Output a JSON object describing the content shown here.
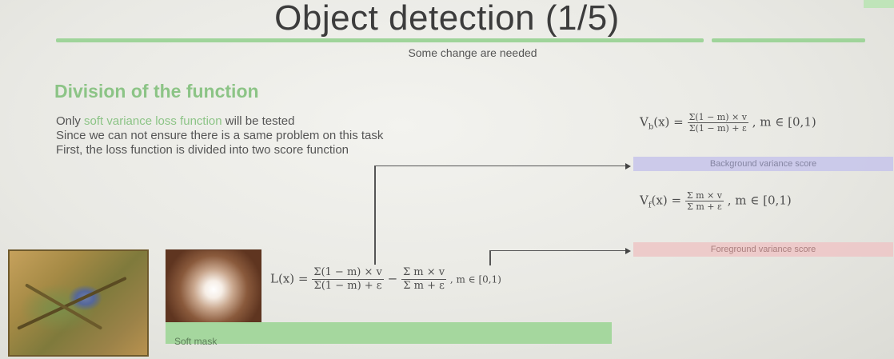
{
  "slide": {
    "title": "Object detection (1/5)",
    "subtitle": "Some change are needed",
    "section_heading": "Division of the function",
    "paragraph": {
      "line1_before": "Only ",
      "line1_highlight": "soft variance loss function",
      "line1_after": " will be tested",
      "line2": "Since we can not ensure there is a same problem on this task",
      "line3": "First, the loss function is divided into two score function"
    },
    "background_formula": {
      "lhs": "V",
      "lhs_sub": "b",
      "arg": "(x) =",
      "numerator": "Σ(1 − m) × v",
      "denominator": "Σ(1 − m) + ε",
      "domain": ", m ∈ [0,1)"
    },
    "background_label": "Background variance score",
    "foreground_formula": {
      "lhs": "V",
      "lhs_sub": "f",
      "arg": "(x) =",
      "numerator": "Σ m × v",
      "denominator": "Σ m + ε",
      "domain": ", m ∈ [0,1)"
    },
    "foreground_label": "Foreground variance score",
    "loss_formula": {
      "lhs": "L(x) =",
      "term1_num": "Σ(1 − m) × v",
      "term1_den": "Σ(1 − m) + ε",
      "minus": "−",
      "term2_num": "Σ m × v",
      "term2_den": "Σ m + ε",
      "domain": ", m ∈ [0,1)"
    },
    "mask_caption": "Soft mask"
  },
  "colors": {
    "accent_green": "#8cc486",
    "background_label_fill": "#c9c7eb",
    "foreground_label_fill": "#eec8c8",
    "caption_bar_fill": "#a5d79e"
  }
}
